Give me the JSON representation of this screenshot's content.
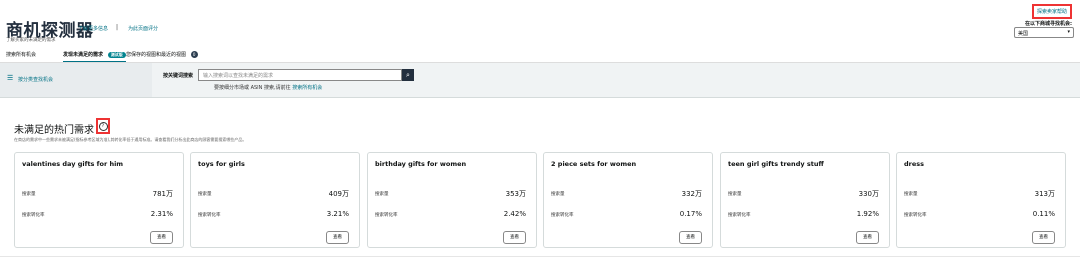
{
  "header": {
    "title": "商机探测器",
    "subtitle": "了解买家的未满足的需求",
    "learn_more": "了解更多信息",
    "separator": "|",
    "feedback": "为此页面评分",
    "top_right_link": "探索卖家帮助",
    "region_label": "在以下商城寻找机会:",
    "region_value": "美国"
  },
  "tabs": [
    {
      "label": "搜索所有机会"
    },
    {
      "label": "发现未满足的需求",
      "badge": "测试版"
    },
    {
      "label": "您保存的视图和最近的视图",
      "count": "0"
    }
  ],
  "search": {
    "side_label": "按分类查找机会",
    "label": "按关键词搜索",
    "placeholder": "输入搜索词以查找未满足的需求",
    "note_prefix": "要按细分市场或 ASIN 搜索,请前往",
    "note_link": "搜索所有机会"
  },
  "section": {
    "title": "未满足的热门需求",
    "help_icon": "question-circle-icon",
    "description": "在商店的需求中一些需求未被满足(指标参考区域为准),其转化率低于通用标准。请查看我们分析出此商店的顾客需要搜索哪些产品。"
  },
  "cards": [
    {
      "keyword": "valentines day gifts for him",
      "metric1_label": "搜索量",
      "metric1_value": "781万",
      "metric2_label": "搜索转化率",
      "metric2_value": "2.31%",
      "button": "查看"
    },
    {
      "keyword": "toys for girls",
      "metric1_label": "搜索量",
      "metric1_value": "409万",
      "metric2_label": "搜索转化率",
      "metric2_value": "3.21%",
      "button": "查看"
    },
    {
      "keyword": "birthday gifts for women",
      "metric1_label": "搜索量",
      "metric1_value": "353万",
      "metric2_label": "搜索转化率",
      "metric2_value": "2.42%",
      "button": "查看"
    },
    {
      "keyword": "2 piece sets for women",
      "metric1_label": "搜索量",
      "metric1_value": "332万",
      "metric2_label": "搜索转化率",
      "metric2_value": "0.17%",
      "button": "查看"
    },
    {
      "keyword": "teen girl gifts trendy stuff",
      "metric1_label": "搜索量",
      "metric1_value": "330万",
      "metric2_label": "搜索转化率",
      "metric2_value": "1.92%",
      "button": "查看"
    },
    {
      "keyword": "dress",
      "metric1_label": "搜索量",
      "metric1_value": "313万",
      "metric2_label": "搜索转化率",
      "metric2_value": "0.11%",
      "button": "查看"
    }
  ],
  "colors": {
    "accent": "#007185",
    "highlight_border": "#ee3333",
    "dark": "#232f3e"
  }
}
